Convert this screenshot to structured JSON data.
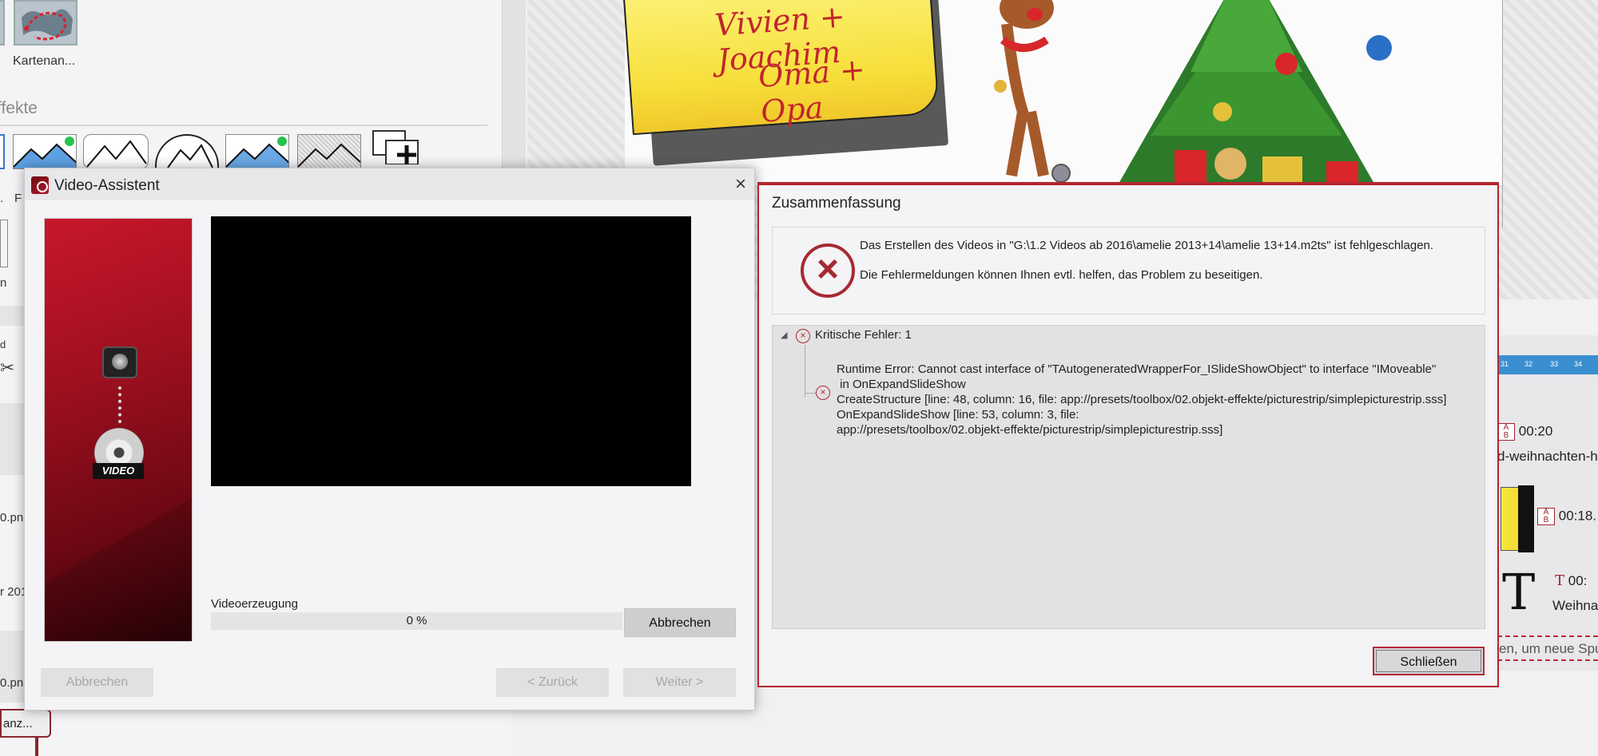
{
  "background": {
    "map_tile_label": "Kartenan...",
    "effects_section_title": "ffekte",
    "left_fragments": [
      "F",
      "n",
      "d",
      "0.pn",
      "r 201",
      "0.pn",
      "anz..."
    ],
    "note_text_line1": "Vivien + Joachim",
    "note_text_line2": "Oma + Opa",
    "timeline": {
      "ruler_ticks": [
        "31",
        "32",
        "33",
        "34"
      ],
      "track1_time": "00:20",
      "track1_name": "d-weihnachten-h",
      "track2_time": "00:18.",
      "track3_time": "00:",
      "track3_name": "Weihna",
      "drop_hint": "en, um neue Spu"
    },
    "icons": [
      "map-icon",
      "scissors-icon",
      "text-icon"
    ]
  },
  "video_assistant": {
    "title": "Video-Assistent",
    "close_glyph": "×",
    "side_disc_label": "VIDEO",
    "progress_label": "Videoerzeugung",
    "progress_text": "0 %",
    "progress_value": 0,
    "abort_progress_button": "Abbrechen",
    "cancel_button": "Abbrechen",
    "back_button": "< Zurück",
    "next_button": "Weiter >"
  },
  "summary": {
    "title": "Zusammenfassung",
    "message_line1": "Das Erstellen des Videos in \"G:\\1.2 Videos ab 2016\\amelie 2013+14\\amelie 13+14.m2ts\" ist fehlgeschlagen.",
    "message_line2": "Die Fehlermeldungen können Ihnen evtl. helfen, das Problem zu beseitigen.",
    "error_glyph": "×",
    "tree_arrow": "◢",
    "tree_header": "Kritische Fehler: 1",
    "error_lines": [
      "Runtime Error: Cannot cast interface of \"TAutogeneratedWrapperFor_ISlideShowObject\" to interface \"IMoveable\"",
      " in OnExpandSlideShow",
      "CreateStructure [line: 48, column: 16, file: app://presets/toolbox/02.objekt-effekte/picturestrip/simplepicturestrip.sss]",
      "OnExpandSlideShow [line: 53, column: 3, file:",
      "app://presets/toolbox/02.objekt-effekte/picturestrip/simplepicturestrip.sss]"
    ],
    "close_button": "Schließen"
  },
  "colors": {
    "accent_red": "#b3262f",
    "dialog_bg": "#f4f3f5",
    "tree_bg": "#e2e1e3"
  }
}
